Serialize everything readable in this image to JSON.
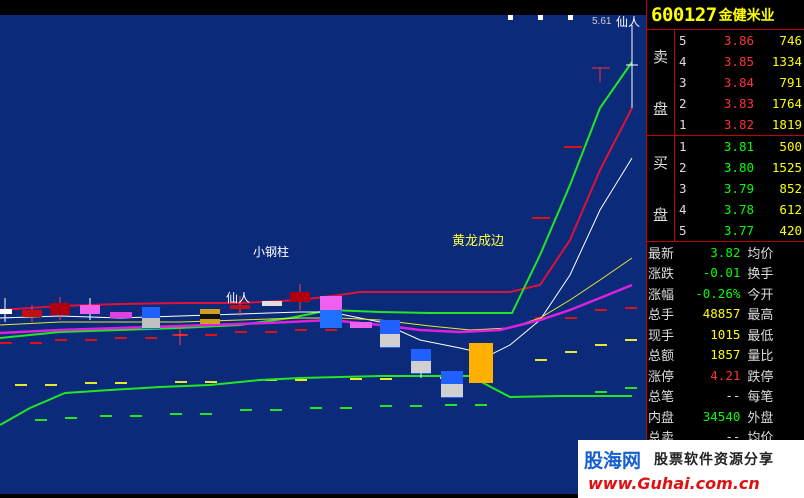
{
  "chart": {
    "price_label": "5.61",
    "annotations": {
      "xianren_top": "仙人",
      "xiaogangzhu": "小钢柱",
      "xianren_mid": "仙人",
      "huanglong": "黄龙成边"
    },
    "colors": {
      "background": "#0b2a7a",
      "ma_green": "#22e622",
      "ma_red": "#e0103a",
      "ma_white": "#ffffff",
      "ma_yellow": "#e8e830",
      "ma_magenta": "#e020e0"
    }
  },
  "quote": {
    "code": "600127",
    "name": "金健米业",
    "sell_side_label": [
      "卖",
      "盘"
    ],
    "buy_side_label": [
      "买",
      "盘"
    ],
    "asks": [
      {
        "level": "5",
        "price": "3.86",
        "volume": "746"
      },
      {
        "level": "4",
        "price": "3.85",
        "volume": "1334"
      },
      {
        "level": "3",
        "price": "3.84",
        "volume": "791"
      },
      {
        "level": "2",
        "price": "3.83",
        "volume": "1764"
      },
      {
        "level": "1",
        "price": "3.82",
        "volume": "1819"
      }
    ],
    "bids": [
      {
        "level": "1",
        "price": "3.81",
        "volume": "500"
      },
      {
        "level": "2",
        "price": "3.80",
        "volume": "1525"
      },
      {
        "level": "3",
        "price": "3.79",
        "volume": "852"
      },
      {
        "level": "4",
        "price": "3.78",
        "volume": "612"
      },
      {
        "level": "5",
        "price": "3.77",
        "volume": "420"
      }
    ],
    "stats": [
      {
        "label": "最新",
        "value": "3.82",
        "color": "#00ff00",
        "label2": "均价"
      },
      {
        "label": "涨跌",
        "value": "-0.01",
        "color": "#00ff00",
        "label2": "换手"
      },
      {
        "label": "涨幅",
        "value": "-0.26%",
        "color": "#00ff00",
        "label2": "今开"
      },
      {
        "label": "总手",
        "value": "48857",
        "color": "#ffff00",
        "label2": "最高"
      },
      {
        "label": "现手",
        "value": "1015",
        "color": "#ffff00",
        "label2": "最低"
      },
      {
        "label": "总额",
        "value": "1857",
        "color": "#ffff00",
        "label2": "量比"
      },
      {
        "label": "涨停",
        "value": "4.21",
        "color": "#ff3030",
        "label2": "跌停"
      },
      {
        "label": "总笔",
        "value": "--",
        "color": "#dddddd",
        "label2": "每笔"
      },
      {
        "label": "内盘",
        "value": "34540",
        "color": "#00ff00",
        "label2": "外盘"
      },
      {
        "label": "总卖",
        "value": "--",
        "color": "#dddddd",
        "label2": "均价"
      }
    ]
  },
  "watermark": {
    "brand": "股海网",
    "slogan": "股票软件资源分享",
    "url": "www.Guhai.com.cn"
  }
}
